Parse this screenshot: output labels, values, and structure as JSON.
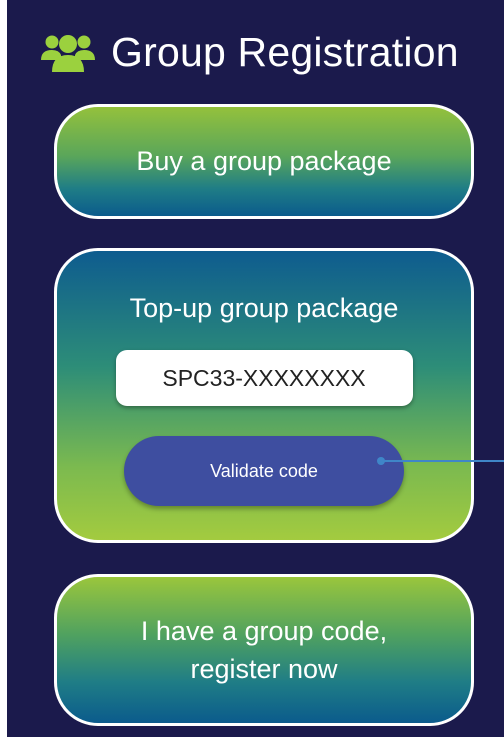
{
  "header": {
    "icon": "users-group-icon",
    "title": "Group Registration"
  },
  "buy_card": {
    "label": "Buy a group package"
  },
  "topup_card": {
    "title": "Top-up group package",
    "code_input": {
      "placeholder": "SPC33-XXXXXXXX",
      "value": ""
    },
    "validate_label": "Validate code"
  },
  "register_card": {
    "line1": "I have a group code,",
    "line2": "register now"
  },
  "colors": {
    "background": "#1b1a4c",
    "accent_green": "#a3cb3f",
    "accent_blue": "#0b5b8c",
    "button_blue": "#3e4ea0",
    "pointer_line": "#3f86c8",
    "icon_green": "#9bd13e"
  }
}
